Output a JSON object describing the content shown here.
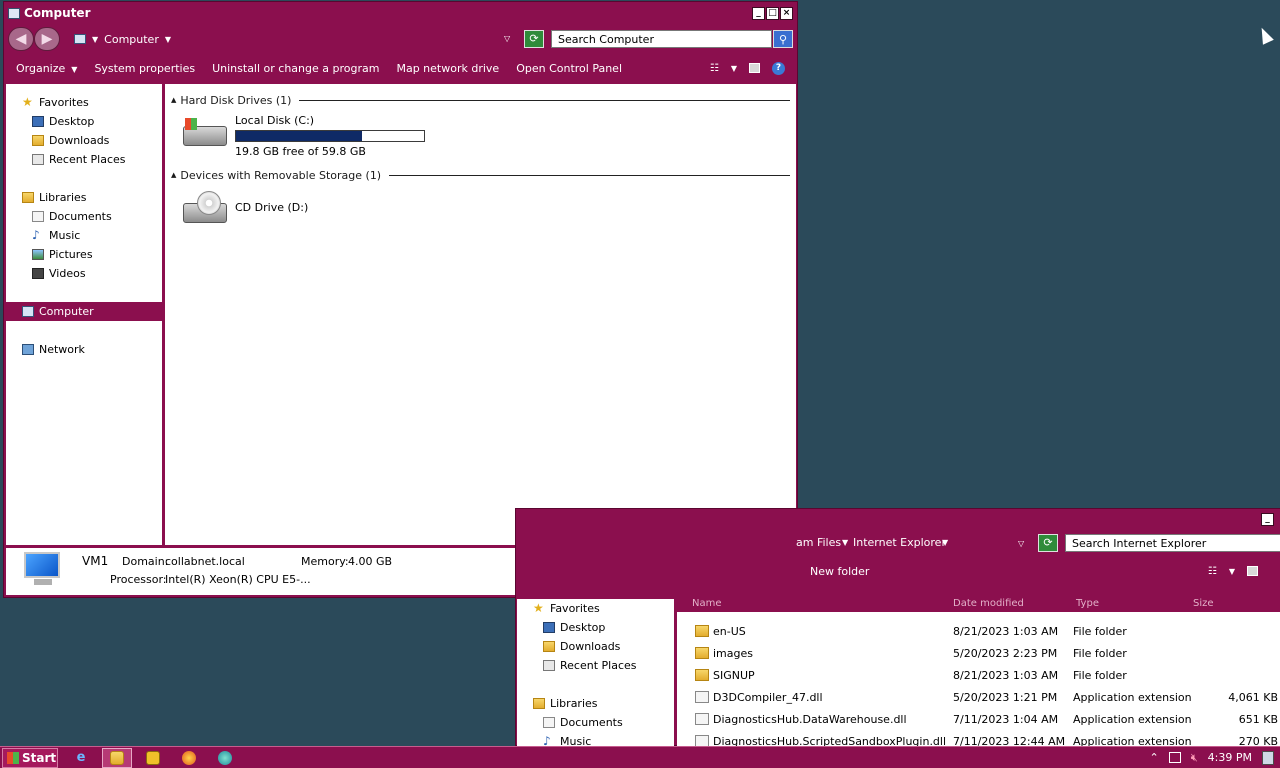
{
  "computer_window": {
    "title": "Computer",
    "window_buttons": [
      "_",
      "□",
      "×"
    ],
    "breadcrumb": "Computer",
    "search_placeholder": "Search Computer",
    "toolbar": {
      "organize": "Organize",
      "system_properties": "System properties",
      "uninstall": "Uninstall or change a program",
      "map_drive": "Map network drive",
      "control_panel": "Open Control Panel"
    },
    "nav": {
      "favorites": "Favorites",
      "desktop": "Desktop",
      "downloads": "Downloads",
      "recent": "Recent Places",
      "libraries": "Libraries",
      "documents": "Documents",
      "music": "Music",
      "pictures": "Pictures",
      "videos": "Videos",
      "computer": "Computer",
      "network": "Network"
    },
    "groups": {
      "hard_disk": "Hard Disk Drives (1)",
      "removable": "Devices with Removable Storage (1)"
    },
    "local_disk": {
      "name": "Local Disk (C:)",
      "free_text": "19.8 GB free of 59.8 GB",
      "used_fraction": 0.669
    },
    "cd_drive": {
      "name": "CD Drive (D:)"
    },
    "details": {
      "name": "VM1",
      "domain_label": "Domain:",
      "domain": "collabnet.local",
      "memory_label": "Memory:",
      "memory": "4.00 GB",
      "processor_label": "Processor:",
      "processor": "Intel(R) Xeon(R) CPU E5-..."
    }
  },
  "ie_window": {
    "breadcrumb_part1": "am Files",
    "breadcrumb_part2": "Internet Explorer",
    "search_placeholder": "Search Internet Explorer",
    "new_folder": "New folder",
    "nav": {
      "favorites": "Favorites",
      "desktop": "Desktop",
      "downloads": "Downloads",
      "recent": "Recent Places",
      "libraries": "Libraries",
      "documents": "Documents",
      "music": "Music"
    },
    "columns": [
      "Name",
      "Date modified",
      "Type",
      "Size"
    ],
    "rows": [
      {
        "name": "en-US",
        "date": "8/21/2023 1:03 AM",
        "type": "File folder",
        "size": ""
      },
      {
        "name": "images",
        "date": "5/20/2023 2:23 PM",
        "type": "File folder",
        "size": ""
      },
      {
        "name": "SIGNUP",
        "date": "8/21/2023 1:03 AM",
        "type": "File folder",
        "size": ""
      },
      {
        "name": "D3DCompiler_47.dll",
        "date": "5/20/2023 1:21 PM",
        "type": "Application extension",
        "size": "4,061 KB"
      },
      {
        "name": "DiagnosticsHub.DataWarehouse.dll",
        "date": "7/11/2023 1:04 AM",
        "type": "Application extension",
        "size": "651 KB"
      },
      {
        "name": "DiagnosticsHub.ScriptedSandboxPlugin.dll",
        "date": "7/11/2023 12:44 AM",
        "type": "Application extension",
        "size": "270 KB"
      }
    ]
  },
  "taskbar": {
    "start": "Start",
    "clock": "4:39 PM"
  }
}
